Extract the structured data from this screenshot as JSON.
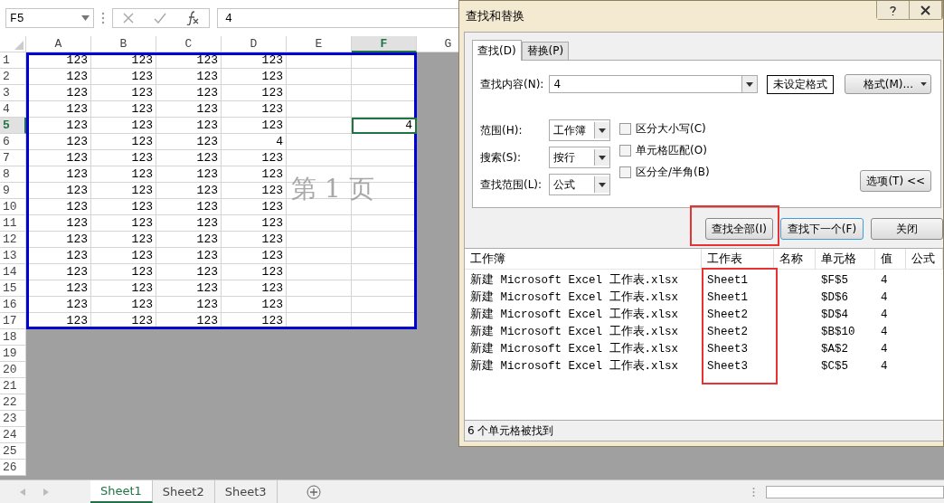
{
  "formula_bar": {
    "name_box": "F5",
    "value": "4"
  },
  "sheet": {
    "columns": [
      {
        "label": "A",
        "selected": false
      },
      {
        "label": "B",
        "selected": false
      },
      {
        "label": "C",
        "selected": false
      },
      {
        "label": "D",
        "selected": false
      },
      {
        "label": "E",
        "selected": false
      },
      {
        "label": "F",
        "selected": true
      },
      {
        "label": "G",
        "selected": false
      }
    ],
    "page_label": "第 1 页",
    "rows": [
      {
        "label": "1",
        "selected": false,
        "cells": [
          "123",
          "123",
          "123",
          "123",
          "",
          ""
        ]
      },
      {
        "label": "2",
        "selected": false,
        "cells": [
          "123",
          "123",
          "123",
          "123",
          "",
          ""
        ]
      },
      {
        "label": "3",
        "selected": false,
        "cells": [
          "123",
          "123",
          "123",
          "123",
          "",
          ""
        ]
      },
      {
        "label": "4",
        "selected": false,
        "cells": [
          "123",
          "123",
          "123",
          "123",
          "",
          ""
        ]
      },
      {
        "label": "5",
        "selected": true,
        "cells": [
          "123",
          "123",
          "123",
          "123",
          "",
          "4"
        ]
      },
      {
        "label": "6",
        "selected": false,
        "cells": [
          "123",
          "123",
          "123",
          "4",
          "",
          ""
        ]
      },
      {
        "label": "7",
        "selected": false,
        "cells": [
          "123",
          "123",
          "123",
          "123",
          "",
          ""
        ]
      },
      {
        "label": "8",
        "selected": false,
        "cells": [
          "123",
          "123",
          "123",
          "123",
          "",
          ""
        ]
      },
      {
        "label": "9",
        "selected": false,
        "cells": [
          "123",
          "123",
          "123",
          "123",
          "",
          ""
        ]
      },
      {
        "label": "10",
        "selected": false,
        "cells": [
          "123",
          "123",
          "123",
          "123",
          "",
          ""
        ]
      },
      {
        "label": "11",
        "selected": false,
        "cells": [
          "123",
          "123",
          "123",
          "123",
          "",
          ""
        ]
      },
      {
        "label": "12",
        "selected": false,
        "cells": [
          "123",
          "123",
          "123",
          "123",
          "",
          ""
        ]
      },
      {
        "label": "13",
        "selected": false,
        "cells": [
          "123",
          "123",
          "123",
          "123",
          "",
          ""
        ]
      },
      {
        "label": "14",
        "selected": false,
        "cells": [
          "123",
          "123",
          "123",
          "123",
          "",
          ""
        ]
      },
      {
        "label": "15",
        "selected": false,
        "cells": [
          "123",
          "123",
          "123",
          "123",
          "",
          ""
        ]
      },
      {
        "label": "16",
        "selected": false,
        "cells": [
          "123",
          "123",
          "123",
          "123",
          "",
          ""
        ]
      },
      {
        "label": "17",
        "selected": false,
        "cells": [
          "123",
          "123",
          "123",
          "123",
          "",
          ""
        ]
      },
      {
        "label": "18",
        "selected": false
      },
      {
        "label": "19",
        "selected": false
      },
      {
        "label": "20",
        "selected": false
      },
      {
        "label": "21",
        "selected": false
      },
      {
        "label": "22",
        "selected": false
      },
      {
        "label": "23",
        "selected": false
      },
      {
        "label": "24",
        "selected": false
      },
      {
        "label": "25",
        "selected": false
      },
      {
        "label": "26",
        "selected": false
      }
    ]
  },
  "sheet_tabs": [
    {
      "label": "Sheet1",
      "selected": true
    },
    {
      "label": "Sheet2",
      "selected": false
    },
    {
      "label": "Sheet3",
      "selected": false
    }
  ],
  "dialog": {
    "title": "查找和替换",
    "tabs": [
      {
        "label": "查找(D)",
        "selected": true
      },
      {
        "label": "替换(P)",
        "selected": false
      }
    ],
    "find_what": {
      "label": "查找内容(N):",
      "value": "4"
    },
    "format_status": "未设定格式",
    "format_button": "格式(M)...",
    "options": [
      {
        "label": "范围(H):",
        "value": "工作簿"
      },
      {
        "label": "搜索(S):",
        "value": "按行"
      },
      {
        "label": "查找范围(L):",
        "value": "公式"
      }
    ],
    "checkboxes": [
      {
        "label": "区分大小写(C)",
        "checked": false
      },
      {
        "label": "单元格匹配(O)",
        "checked": false
      },
      {
        "label": "区分全/半角(B)",
        "checked": false
      }
    ],
    "options_button": "选项(T) <<",
    "buttons": [
      {
        "label": "查找全部(I)",
        "highlighted": true,
        "default": false
      },
      {
        "label": "查找下一个(F)",
        "highlighted": false,
        "default": true
      },
      {
        "label": "关闭",
        "highlighted": false,
        "default": false
      }
    ],
    "results": {
      "columns": [
        {
          "label": "工作簿",
          "highlighted": false
        },
        {
          "label": "工作表",
          "highlighted": true
        },
        {
          "label": "名称",
          "highlighted": false
        },
        {
          "label": "单元格",
          "highlighted": false
        },
        {
          "label": "值",
          "highlighted": false
        },
        {
          "label": "公式",
          "highlighted": false
        }
      ],
      "rows": [
        [
          "新建 Microsoft Excel 工作表.xlsx",
          "Sheet1",
          "",
          "$F$5",
          "4",
          ""
        ],
        [
          "新建 Microsoft Excel 工作表.xlsx",
          "Sheet1",
          "",
          "$D$6",
          "4",
          ""
        ],
        [
          "新建 Microsoft Excel 工作表.xlsx",
          "Sheet2",
          "",
          "$D$4",
          "4",
          ""
        ],
        [
          "新建 Microsoft Excel 工作表.xlsx",
          "Sheet2",
          "",
          "$B$10",
          "4",
          ""
        ],
        [
          "新建 Microsoft Excel 工作表.xlsx",
          "Sheet3",
          "",
          "$A$2",
          "4",
          ""
        ],
        [
          "新建 Microsoft Excel 工作表.xlsx",
          "Sheet3",
          "",
          "$C$5",
          "4",
          ""
        ]
      ]
    },
    "status": "6 个单元格被找到"
  }
}
